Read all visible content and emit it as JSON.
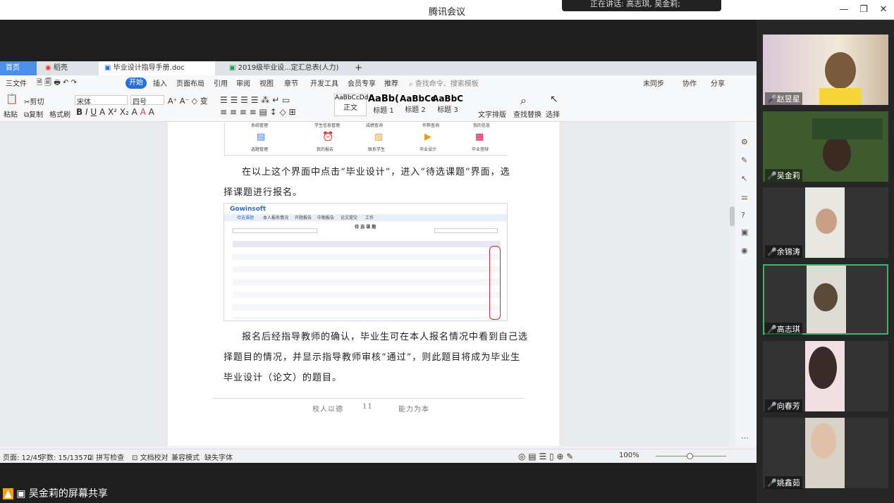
{
  "window": {
    "title": "腾讯会议",
    "speaking": "正在讲话: 高志琪, 吴金莉;"
  },
  "wps": {
    "tabs": [
      "首页",
      "稻壳",
      "毕业设计指导手册.doc",
      "2019级毕业设...定汇总表(人力)"
    ],
    "menus": [
      "三文件",
      "开始",
      "插入",
      "页面布局",
      "引用",
      "审阅",
      "视图",
      "章节",
      "开发工具",
      "会员专享",
      "推荐"
    ],
    "search": "查找命令、搜索模板",
    "right_menus": [
      "未同步",
      "协作",
      "分享"
    ],
    "ribbon": {
      "paste": "粘贴",
      "cut": "剪切",
      "copy": "复制",
      "format_painter": "格式刷",
      "font": "宋体",
      "size": "四号",
      "styles": [
        {
          "sample": "AaBbCcDd",
          "name": "正文"
        },
        {
          "sample": "AaBb(",
          "name": "标题 1"
        },
        {
          "sample": "AaBbCc",
          "name": "标题 2"
        },
        {
          "sample": "AaBbC",
          "name": "标题 3"
        }
      ],
      "text_layout": "文字排版",
      "find_replace": "查找替换",
      "select": "选择"
    }
  },
  "doc": {
    "icons_top": [
      "系统管理",
      "学生信息管理",
      "成绩查询",
      "作弊查询",
      "我的信息"
    ],
    "icons_row": [
      "选题管理",
      "我的报告",
      "联系学生",
      "毕业设计",
      "毕业答辩"
    ],
    "para1a": "在以上这个界面中点击“毕业设计”，进入“待选课题”界面，选",
    "para1b": "择课题进行报名。",
    "para2a": "报名后经指导教师的确认，毕业生可在本人报名情况中看到自己选",
    "para2b": "择题目的情况，并显示指导教师审核“通过”，则此题目将成为毕业生",
    "para2c": "毕业设计（论文）的题目。",
    "footer_left": "校人以德",
    "footer_num": "11",
    "footer_right": "能力为本",
    "shot": {
      "logo": "Gowinsoft",
      "nav": [
        "待选课题",
        "本人报名情况",
        "开题报告",
        "中期报告",
        "论文提交",
        "工作"
      ],
      "title": "待 选 课 题"
    }
  },
  "status": {
    "page": "页面: 12/45",
    "words": "字数: 15/13570",
    "spell": "拼写检查",
    "proof": "文档校对",
    "compat": "兼容模式",
    "missing_font": "缺失字体",
    "zoom": "100%"
  },
  "share_label": "吴金莉的屏幕共享",
  "participants": [
    {
      "name": "赵昱星"
    },
    {
      "name": "吴金莉"
    },
    {
      "name": "余锦涛"
    },
    {
      "name": "高志琪"
    },
    {
      "name": "向春芳"
    },
    {
      "name": "姚鑫茹"
    }
  ],
  "colors": {
    "accent": "#2a6fd6",
    "active_border": "#3cb371"
  }
}
